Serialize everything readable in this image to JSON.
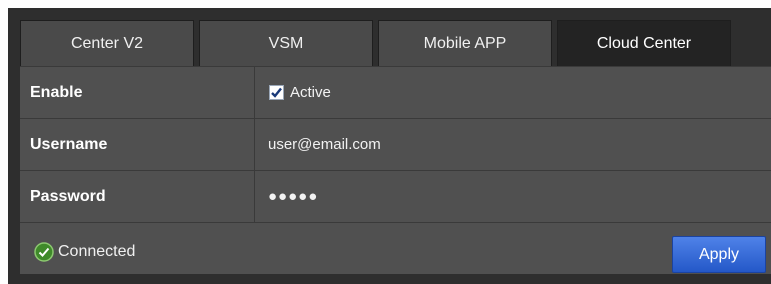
{
  "tabs": [
    {
      "label": "Center V2"
    },
    {
      "label": "VSM"
    },
    {
      "label": "Mobile APP"
    },
    {
      "label": "Cloud Center"
    }
  ],
  "active_tab": "Cloud Center",
  "form": {
    "enable": {
      "label": "Enable",
      "checkbox_label": "Active",
      "checked": true
    },
    "username": {
      "label": "Username",
      "value": "user@email.com"
    },
    "password": {
      "label": "Password",
      "value": "●●●●●"
    }
  },
  "status": {
    "text": "Connected",
    "icon": "check-circle-icon",
    "color": "#3f8a2a"
  },
  "apply_label": "Apply",
  "colors": {
    "accent": "#2f63d6",
    "background": "#505050",
    "active_tab": "#232323"
  }
}
